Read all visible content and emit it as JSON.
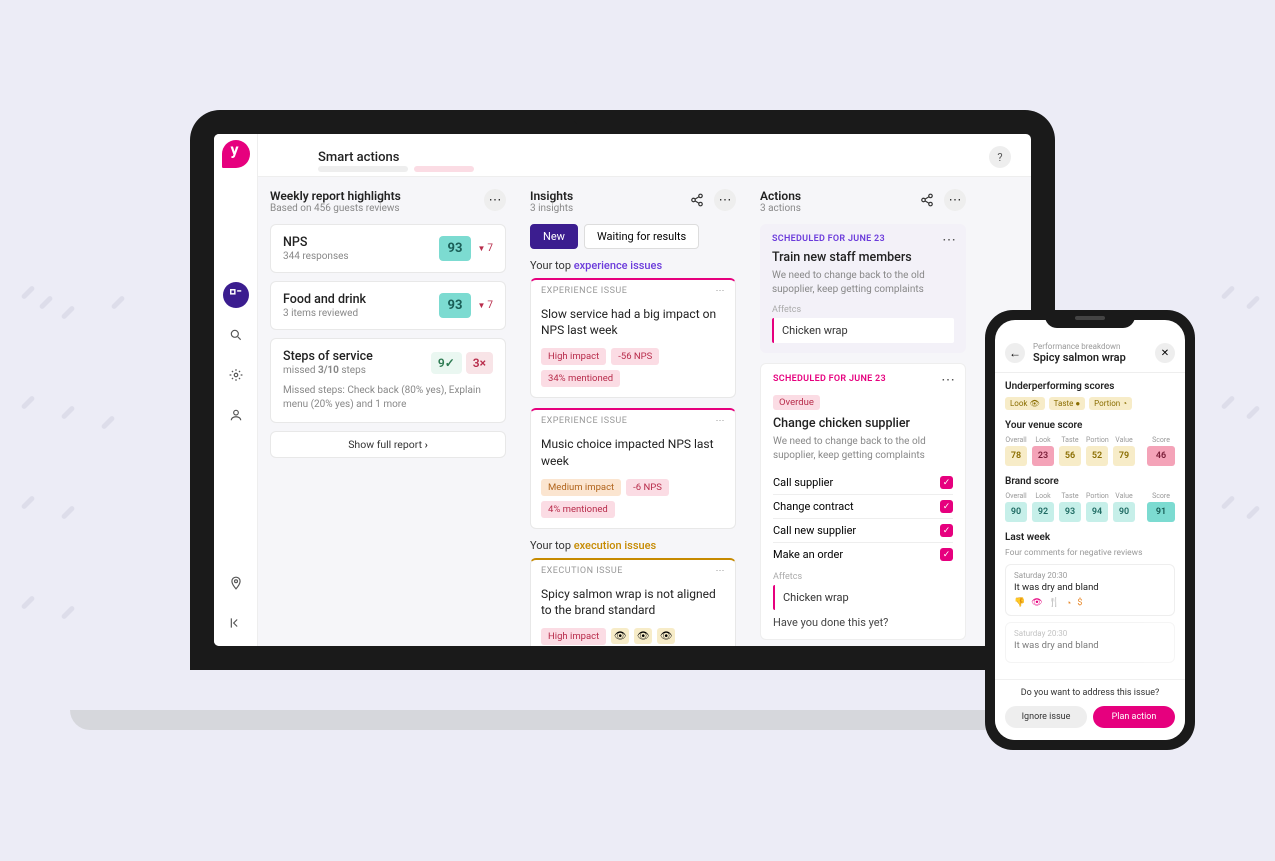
{
  "header": {
    "title": "Smart actions",
    "help": "?"
  },
  "sidebar": {
    "items": [
      "tasks",
      "search",
      "settings",
      "user"
    ]
  },
  "weekly": {
    "title": "Weekly report highlights",
    "subtitle": "Based on 456 guests reviews",
    "cards": [
      {
        "title": "NPS",
        "sub": "344 responses",
        "score": "93",
        "delta": "7"
      },
      {
        "title": "Food and drink",
        "sub": "3 items reviewed",
        "score": "93",
        "delta": "7"
      }
    ],
    "steps": {
      "title": "Steps of service",
      "sub_prefix": "missed ",
      "sub_bold": "3/10",
      "sub_suffix": " steps",
      "ok": "9",
      "ok_mark": "✓",
      "bad": "3",
      "bad_mark": "×",
      "meta": "Missed steps: Check back (80% yes), Explain menu (20% yes) and 1 more"
    },
    "show_full": "Show full report"
  },
  "insights": {
    "title": "Insights",
    "subtitle": "3 insights",
    "tabs": {
      "new": "New",
      "waiting": "Waiting for results"
    },
    "exp_head_prefix": "Your top ",
    "exp_head_link": "experience issues",
    "exec_head_prefix": "Your top ",
    "exec_head_link": "execution issues",
    "issue_label_exp": "EXPERIENCE ISSUE",
    "issue_label_exec": "EXECUTION ISSUE",
    "exp": [
      {
        "text": "Slow service had a big impact on NPS last week",
        "chips": [
          "High impact",
          "-56 NPS",
          "34% mentioned"
        ]
      },
      {
        "text": "Music choice impacted NPS last week",
        "chips": [
          "Medium impact",
          "-6 NPS",
          "4% mentioned"
        ]
      }
    ],
    "exec": [
      {
        "text": "Spicy salmon wrap is not aligned to the brand standard",
        "chips": [
          "High impact"
        ]
      }
    ]
  },
  "actions": {
    "title": "Actions",
    "subtitle": "3 actions",
    "sched_label": "SCHEDULED FOR JUNE 23",
    "overdue": "Overdue",
    "affects_label": "Affetcs",
    "items": [
      {
        "title": "Train new staff members",
        "desc": "We need to change back to the old supoplier, keep getting complaints",
        "affects": "Chicken wrap"
      },
      {
        "title": "Change chicken supplier",
        "desc": "We need to change back to the old supoplier, keep getting complaints",
        "checklist": [
          "Call supplier",
          "Change contract",
          "Call new supplier",
          "Make an order"
        ],
        "affects": "Chicken wrap"
      }
    ],
    "done_prompt": "Have you done this yet?"
  },
  "phone": {
    "crumb": "Performance breakdown",
    "title": "Spicy salmon wrap",
    "under_title": "Underperforming scores",
    "under_chips": [
      "Look",
      "Taste",
      "Portion"
    ],
    "venue_title": "Your venue score",
    "labels": [
      "Overall",
      "Look",
      "Taste",
      "Portion",
      "Value"
    ],
    "score_label": "Score",
    "venue_scores": [
      "78",
      "23",
      "56",
      "52",
      "79"
    ],
    "venue_total": "46",
    "brand_title": "Brand score",
    "brand_scores": [
      "90",
      "92",
      "93",
      "94",
      "90"
    ],
    "brand_total": "91",
    "last_week_title": "Last week",
    "last_week_sub": "Four comments for negative reviews",
    "reviews": [
      {
        "time": "Saturday 20:30",
        "text": "It was dry and bland"
      },
      {
        "time": "Saturday 20:30",
        "text": "It was dry and bland"
      }
    ],
    "footer_prompt": "Do you want to address this issue?",
    "ignore": "Ignore issue",
    "plan": "Plan action"
  }
}
